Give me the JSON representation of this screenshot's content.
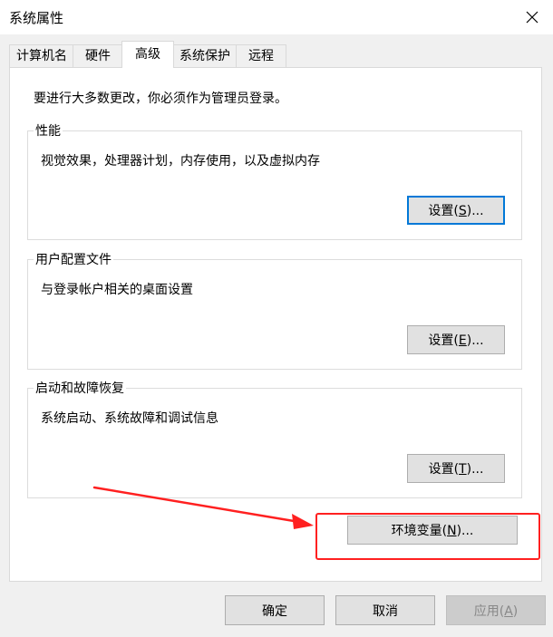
{
  "window": {
    "title": "系统属性",
    "close_icon": "close-icon"
  },
  "tabs": [
    {
      "label": "计算机名"
    },
    {
      "label": "硬件"
    },
    {
      "label": "高级",
      "active": true
    },
    {
      "label": "系统保护"
    },
    {
      "label": "远程"
    }
  ],
  "advanced": {
    "admin_note": "要进行大多数更改，你必须作为管理员登录。",
    "performance": {
      "title": "性能",
      "description": "视觉效果，处理器计划，内存使用，以及虚拟内存",
      "button": {
        "label": "设置(",
        "mnemonic": "S",
        "suffix": ")..."
      }
    },
    "user_profiles": {
      "title": "用户配置文件",
      "description": "与登录帐户相关的桌面设置",
      "button": {
        "label": "设置(",
        "mnemonic": "E",
        "suffix": ")..."
      }
    },
    "startup_recovery": {
      "title": "启动和故障恢复",
      "description": "系统启动、系统故障和调试信息",
      "button": {
        "label": "设置(",
        "mnemonic": "T",
        "suffix": ")..."
      }
    },
    "env_vars_button": {
      "label": "环境变量(",
      "mnemonic": "N",
      "suffix": ")..."
    }
  },
  "footer": {
    "ok": "确定",
    "cancel": "取消",
    "apply": {
      "label": "应用(",
      "mnemonic": "A",
      "suffix": ")"
    }
  },
  "annotation": {
    "color": "#ff2020"
  },
  "colors": {
    "focus_border": "#0078d7",
    "button_bg": "#e1e1e1"
  }
}
